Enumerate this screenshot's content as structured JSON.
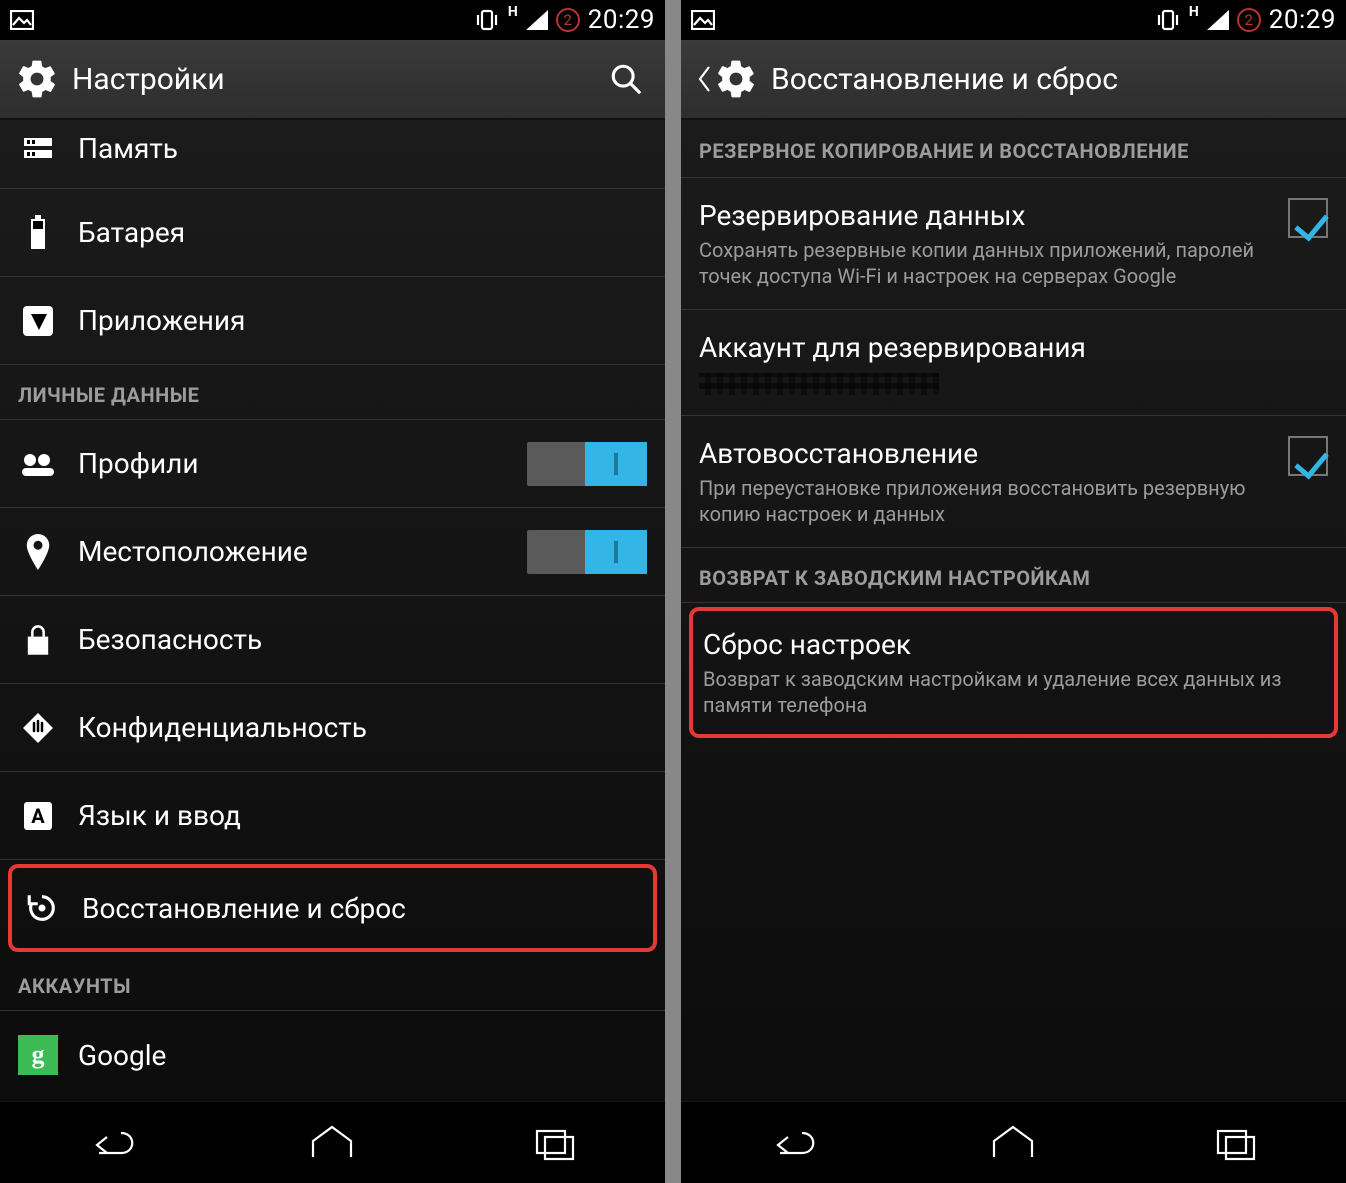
{
  "status": {
    "network_indicator": "H",
    "sim_badge": "2",
    "time": "20:29"
  },
  "left": {
    "toolbar": {
      "title": "Настройки"
    },
    "rows": {
      "memory": "Память",
      "battery": "Батарея",
      "apps": "Приложения"
    },
    "section_personal": "ЛИЧНЫЕ ДАННЫЕ",
    "rows2": {
      "profiles": "Профили",
      "location": "Местоположение",
      "security": "Безопасность",
      "privacy": "Конфиденциальность",
      "language": "Язык и ввод",
      "backup_reset": "Восстановление и сброс"
    },
    "section_accounts": "АККАУНТЫ",
    "rows3": {
      "google": "Google"
    }
  },
  "right": {
    "toolbar": {
      "title": "Восстановление и сброс"
    },
    "section_backup": "РЕЗЕРВНОЕ КОПИРОВАНИЕ И ВОССТАНОВЛЕНИЕ",
    "backup_data": {
      "title": "Резервирование данных",
      "sub": "Сохранять резервные копии данных приложений, паролей точек доступа Wi-Fi и настроек на серверах Google"
    },
    "backup_account": {
      "title": "Аккаунт для резервирования"
    },
    "auto_restore": {
      "title": "Автовосстановление",
      "sub": "При переустановке приложения восстановить резервную копию настроек и данных"
    },
    "section_factory": "ВОЗВРАТ К ЗАВОДСКИМ НАСТРОЙКАМ",
    "factory_reset": {
      "title": "Сброс настроек",
      "sub": "Возврат к заводским настройкам и удаление всех данных из памяти телефона"
    }
  }
}
